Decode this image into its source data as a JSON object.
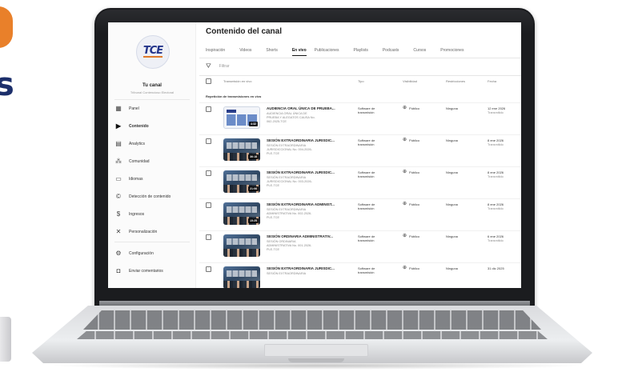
{
  "colors": {
    "brand_orange": "#e9802a",
    "brand_navy": "#1c2f6b",
    "tce_blue": "#24358a"
  },
  "logo": {
    "text": "TCE",
    "icon": "tce-logo"
  },
  "left_fragment": {
    "text": "s"
  },
  "channel": {
    "name": "Tu canal",
    "subtitle": "Tribunal Contencioso Electoral"
  },
  "sidebar": {
    "items": [
      {
        "label": "Panel",
        "icon": "dashboard-icon"
      },
      {
        "label": "Contenido",
        "icon": "video-content-icon",
        "active": true
      },
      {
        "label": "Analytics",
        "icon": "bar-chart-icon"
      },
      {
        "label": "Comunidad",
        "icon": "people-icon"
      },
      {
        "label": "Idiomas",
        "icon": "subtitles-icon"
      },
      {
        "label": "Detección de contenido",
        "icon": "copyright-icon"
      },
      {
        "label": "Ingresos",
        "icon": "dollar-icon"
      },
      {
        "label": "Personalización",
        "icon": "magic-wand-icon"
      },
      {
        "label": "Configuración",
        "icon": "gear-icon"
      },
      {
        "label": "Enviar comentarios",
        "icon": "feedback-icon"
      }
    ]
  },
  "main": {
    "title": "Contenido del canal",
    "tabs": [
      "Inspiración",
      "Videos",
      "Shorts",
      "En vivo",
      "Publicaciones",
      "Playlists",
      "Podcasts",
      "Cursos",
      "Promociones"
    ],
    "active_tab": "En vivo",
    "filter_placeholder": "Filtrar",
    "columns": [
      "Transmisión en vivo",
      "Tipo",
      "Visibilidad",
      "Restricciones",
      "Fecha"
    ],
    "section_label": "Repetición de transmisiones en vivo",
    "rows": [
      {
        "title": "AUDIENCIA ORAL ÚNICA DE PRUEBA...",
        "description": "AUDIENCIA ORAL ÚNICA DE PRUEBA Y ALEGATOS CAUSA No. 062-2025-TCE",
        "duration": "4:32",
        "type": "Software de transmisión",
        "visibility": "Público",
        "restrictions": "Ninguna",
        "date": "12 ene 2026",
        "date_note": "Transmitido"
      },
      {
        "title": "SESIÓN EXTRAORDINARIA JURISDIC...",
        "description": "SESIÓN EXTRAORDINARIA JURISDICCIONAL No. 004-2026-PLE-TCE",
        "duration": "36:18",
        "type": "Software de transmisión",
        "visibility": "Público",
        "restrictions": "Ninguna",
        "date": "8 ene 2026",
        "date_note": "Transmitido"
      },
      {
        "title": "SESIÓN EXTRAORDINARIA JURISDIC...",
        "description": "SESIÓN EXTRAORDINARIA JURISDICCIONAL No. 003-2026-PLE-TCE",
        "duration": "21:06",
        "type": "Software de transmisión",
        "visibility": "Público",
        "restrictions": "Ninguna",
        "date": "8 ene 2026",
        "date_note": "Transmitido"
      },
      {
        "title": "SESIÓN EXTRAORDINARIA ADMINIST...",
        "description": "SESIÓN EXTRAORDINARIA ADMINISTRATIVA No. 002-2026-PLE-TCE",
        "duration": "15:25",
        "type": "Software de transmisión",
        "visibility": "Público",
        "restrictions": "Ninguna",
        "date": "8 ene 2026",
        "date_note": "Transmitido"
      },
      {
        "title": "SESIÓN ORDINARIA ADMINISTRATIV...",
        "description": "SESIÓN ORDINARIA ADMINISTRATIVA No. 001-2026-PLE-TCE",
        "duration": "",
        "type": "Software de transmisión",
        "visibility": "Público",
        "restrictions": "Ninguna",
        "date": "6 ene 2026",
        "date_note": "Transmitido"
      },
      {
        "title": "SESIÓN EXTRAORDINARIA JURISDIC...",
        "description": "SESIÓN EXTRAORDINARIA",
        "duration": "",
        "type": "Software de transmisión",
        "visibility": "Público",
        "restrictions": "Ninguna",
        "date": "31 dic 2025",
        "date_note": ""
      }
    ]
  }
}
